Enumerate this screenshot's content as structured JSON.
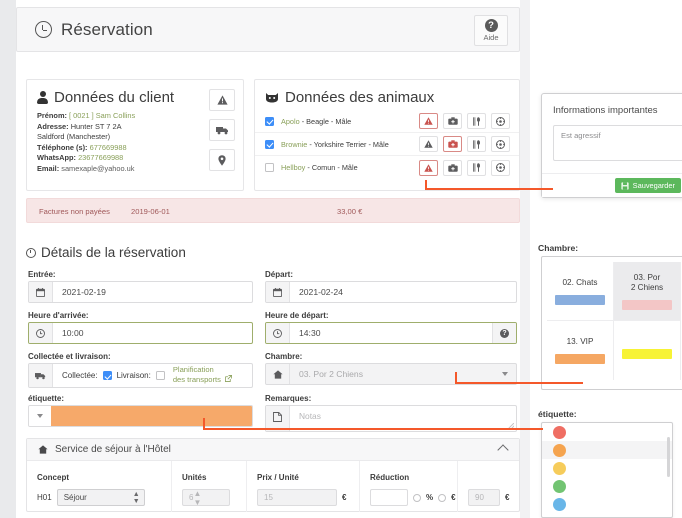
{
  "header": {
    "title": "Réservation",
    "clock_icon": "clock-icon",
    "help_label": "Aide",
    "help_icon": "question-circle-icon"
  },
  "client_card": {
    "title": "Données du client",
    "person_icon": "person-icon",
    "fields": [
      {
        "label": "Prénom:",
        "value": "[ 0021 ] Sam Collins",
        "style": "green"
      },
      {
        "label": "Adresse:",
        "value": "Hunter ST 7 2A",
        "style": "dark"
      },
      {
        "label": "",
        "value": "Saldford (Manchester)",
        "style": "dark"
      },
      {
        "label": "Téléphone (s):",
        "value": "677669988",
        "style": "green"
      },
      {
        "label": "WhatsApp:",
        "value": "23677669988",
        "style": "green"
      },
      {
        "label": "Email:",
        "value": "samexaple@yahoo.uk",
        "style": "grey"
      }
    ],
    "side_buttons": [
      {
        "icon": "warning-triangle-icon",
        "name": "client-warning-button"
      },
      {
        "icon": "truck-icon",
        "name": "client-transport-button"
      },
      {
        "icon": "map-pin-icon",
        "name": "client-location-button"
      }
    ]
  },
  "animals_card": {
    "title": "Données des animaux",
    "pet_icon": "pet-head-icon",
    "rows": [
      {
        "checked": true,
        "name": "Apolo",
        "detail": " - Beagle - Mâle",
        "alert": true,
        "medical": false
      },
      {
        "checked": true,
        "name": "Brownie",
        "detail": " - Yorkshire Terrier - Mâle",
        "alert": false,
        "medical": true
      },
      {
        "checked": false,
        "name": "Hellboy",
        "detail": " - Comun - Mâle",
        "alert": true,
        "medical": false
      }
    ],
    "row_icons": [
      {
        "icon": "warning-triangle-icon",
        "name": "pet-alert-button"
      },
      {
        "icon": "first-aid-kit-icon",
        "name": "pet-medical-button"
      },
      {
        "icon": "cutlery-icon",
        "name": "pet-food-button"
      },
      {
        "icon": "ball-icon",
        "name": "pet-activity-button"
      }
    ]
  },
  "invoice_bar": {
    "label": "Factures non payées",
    "date": "2019-06-01",
    "amount": "33,00 €"
  },
  "reservation": {
    "section_title": "Détails de la réservation",
    "entry_label": "Entrée:",
    "entry_value": "2021-02-19",
    "entry_icon": "calendar-icon",
    "depart_label": "Départ:",
    "depart_value": "2021-02-24",
    "depart_icon": "calendar-icon",
    "arrival_time_label": "Heure d'arrivée:",
    "arrival_time_value": "10:00",
    "arrival_time_icon": "clock-icon",
    "departure_time_label": "Heure de départ:",
    "departure_time_value": "14:30",
    "departure_time_icon": "clock-icon",
    "departure_help_icon": "question-circle-icon",
    "collect_section_label": "Collectée et livraison:",
    "collect_icon": "truck-icon",
    "collect_label": "Collectée:",
    "collect_checked": true,
    "delivery_label": "Livraison:",
    "delivery_checked": false,
    "transport_link_line1": "Planification",
    "transport_link_line2": "des transports",
    "transport_link_icon": "external-link-icon",
    "room_label": "Chambre:",
    "room_value": "03. Por 2 Chiens",
    "room_icon": "home-icon",
    "tag_label": "étiquette:",
    "tag_color": "#f6a96a",
    "remarks_label": "Remarques:",
    "remarks_placeholder": "Notas",
    "remarks_icon": "note-icon"
  },
  "hotel_panel": {
    "title": "Service de séjour à l'Hôtel",
    "home_icon": "home-icon",
    "collapse_icon": "chevron-up-icon",
    "columns": [
      "Concept",
      "Unités",
      "Prix / Unité",
      "Réduction",
      ""
    ],
    "row": {
      "code": "H01",
      "concept": "Séjour",
      "units": "6",
      "unit_price": "15",
      "unit_price_currency": "€",
      "discount_value": "",
      "discount_pct_symbol": "%",
      "discount_eur_symbol": "€",
      "total": "90",
      "total_currency": "€"
    }
  },
  "overlays": {
    "info_modal": {
      "title": "Informations importantes",
      "note": "Est agressif",
      "save_label": "Sauvegarder",
      "save_icon": "floppy-disk-icon",
      "save_color": "#5cb85c"
    },
    "room_picker": {
      "label": "Chambre:",
      "cells": [
        {
          "name": "02. Chats",
          "color": "#89aede",
          "selected": false
        },
        {
          "name": "03. Por\n2 Chiens",
          "color": "#f3c6c6",
          "selected": true
        },
        {
          "name": "13. VIP",
          "color": "#f5a763",
          "selected": false
        },
        {
          "name": "",
          "color": "#f7f335",
          "selected": false
        }
      ]
    },
    "tag_picker": {
      "label": "étiquette:",
      "options": [
        {
          "color": "#ef6e63",
          "name": "tag-red"
        },
        {
          "color": "#f5a44f",
          "name": "tag-orange"
        },
        {
          "color": "#f6cc5b",
          "name": "tag-yellow"
        },
        {
          "color": "#72c472",
          "name": "tag-green"
        },
        {
          "color": "#69b6e8",
          "name": "tag-blue"
        }
      ]
    }
  },
  "annotation": {
    "color": "#f4582a"
  }
}
